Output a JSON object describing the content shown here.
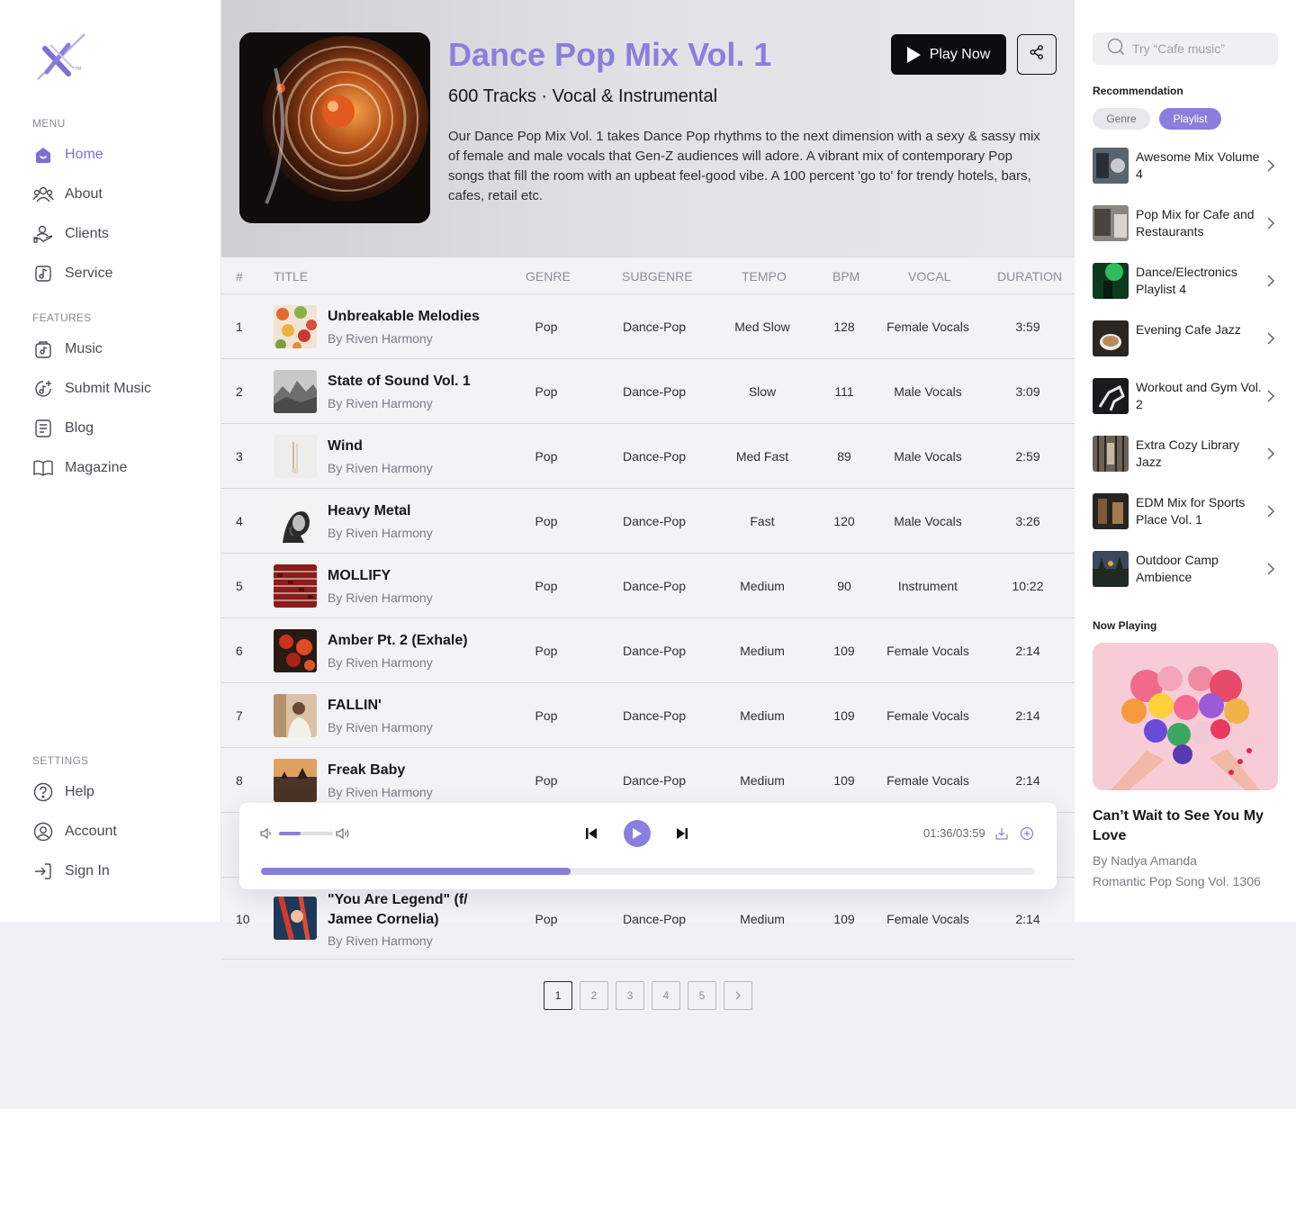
{
  "sidebar": {
    "menu_label": "MENU",
    "features_label": "FEATURES",
    "settings_label": "SETTINGS",
    "menu": [
      {
        "label": "Home",
        "icon": "home-icon",
        "active": true
      },
      {
        "label": "About",
        "icon": "people-icon"
      },
      {
        "label": "Clients",
        "icon": "clients-icon"
      },
      {
        "label": "Service",
        "icon": "service-icon"
      }
    ],
    "features": [
      {
        "label": "Music",
        "icon": "music-icon"
      },
      {
        "label": "Submit Music",
        "icon": "submit-music-icon"
      },
      {
        "label": "Blog",
        "icon": "blog-icon"
      },
      {
        "label": "Magazine",
        "icon": "book-icon"
      }
    ],
    "settings": [
      {
        "label": "Help",
        "icon": "help-icon"
      },
      {
        "label": "Account",
        "icon": "account-icon"
      },
      {
        "label": "Sign In",
        "icon": "sign-in-icon"
      }
    ]
  },
  "hero": {
    "title": "Dance Pop Mix Vol. 1",
    "subtitle": "600 Tracks · Vocal & Instrumental",
    "description": "Our Dance Pop Mix Vol. 1 takes Dance Pop rhythms to the next dimension with a  sexy & sassy mix of female and male vocals that Gen-Z audiences will adore. A vibrant mix of contemporary Pop songs that fill the room with an upbeat feel-good vibe. A 100 percent 'go to' for trendy hotels, bars, cafes, retail etc.",
    "play_label": "Play Now"
  },
  "table": {
    "headers": {
      "num": "#",
      "title": "TITLE",
      "genre": "GENRE",
      "subgenre": "SUBGENRE",
      "tempo": "TEMPO",
      "bpm": "BPM",
      "vocal": "VOCAL",
      "duration": "DURATION"
    },
    "rows": [
      {
        "num": "1",
        "title": "Unbreakable Melodies",
        "artist": "By Riven Harmony",
        "genre": "Pop",
        "subgenre": "Dance-Pop",
        "tempo": "Med Slow",
        "bpm": "128",
        "vocal": "Female Vocals",
        "duration": "3:59"
      },
      {
        "num": "2",
        "title": "State of Sound Vol. 1",
        "artist": "By Riven Harmony",
        "genre": "Pop",
        "subgenre": "Dance-Pop",
        "tempo": "Slow",
        "bpm": "111",
        "vocal": "Male Vocals",
        "duration": "3:09"
      },
      {
        "num": "3",
        "title": "Wind",
        "artist": "By Riven Harmony",
        "genre": "Pop",
        "subgenre": "Dance-Pop",
        "tempo": "Med Fast",
        "bpm": "89",
        "vocal": "Male Vocals",
        "duration": "2:59"
      },
      {
        "num": "4",
        "title": "Heavy Metal",
        "artist": "By Riven Harmony",
        "genre": "Pop",
        "subgenre": "Dance-Pop",
        "tempo": "Fast",
        "bpm": "120",
        "vocal": "Male Vocals",
        "duration": "3:26"
      },
      {
        "num": "5",
        "title": "MOLLIFY",
        "artist": "By Riven Harmony",
        "genre": "Pop",
        "subgenre": "Dance-Pop",
        "tempo": "Medium",
        "bpm": "90",
        "vocal": "Instrument",
        "duration": "10:22"
      },
      {
        "num": "6",
        "title": "Amber Pt. 2 (Exhale)",
        "artist": "By Riven Harmony",
        "genre": "Pop",
        "subgenre": "Dance-Pop",
        "tempo": "Medium",
        "bpm": "109",
        "vocal": "Female Vocals",
        "duration": "2:14"
      },
      {
        "num": "7",
        "title": "FALLIN'",
        "artist": "By Riven Harmony",
        "genre": "Pop",
        "subgenre": "Dance-Pop",
        "tempo": "Medium",
        "bpm": "109",
        "vocal": "Female Vocals",
        "duration": "2:14"
      },
      {
        "num": "8",
        "title": "Freak Baby",
        "artist": "By Riven Harmony",
        "genre": "Pop",
        "subgenre": "Dance-Pop",
        "tempo": "Medium",
        "bpm": "109",
        "vocal": "Female Vocals",
        "duration": "2:14"
      },
      {
        "num": "10",
        "title": "\"You Are Legend\" (f/ Jamee Cornelia)",
        "artist": "By Riven Harmony",
        "genre": "Pop",
        "subgenre": "Dance-Pop",
        "tempo": "Medium",
        "bpm": "109",
        "vocal": "Female Vocals",
        "duration": "2:14"
      }
    ]
  },
  "player": {
    "time": "01:36/03:59",
    "progress_fraction": 0.4,
    "volume_fraction": 0.4
  },
  "pagination": {
    "pages": [
      "1",
      "2",
      "3",
      "4",
      "5"
    ],
    "current": "1"
  },
  "right": {
    "search_placeholder": "Try “Cafe music”",
    "recommendation_label": "Recommendation",
    "chips": {
      "genre": "Genre",
      "playlist": "Playlist"
    },
    "playlists": [
      {
        "title": "Awesome Mix Volume 4"
      },
      {
        "title": "Pop Mix for Cafe and Restaurants"
      },
      {
        "title": "Dance/Electronics Playlist 4"
      },
      {
        "title": "Evening Cafe Jazz"
      },
      {
        "title": "Workout and Gym Vol. 2"
      },
      {
        "title": "Extra Cozy Library Jazz"
      },
      {
        "title": "EDM Mix for Sports Place Vol. 1"
      },
      {
        "title": "Outdoor Camp Ambience"
      }
    ],
    "now_playing_label": "Now Playing",
    "now_playing": {
      "title": "Can’t Wait to See You My Love",
      "artist": "By Nadya Amanda",
      "album": "Romantic Pop Song Vol. 1306"
    }
  },
  "colors": {
    "accent": "#8a7fdc",
    "dark": "#0d0d10"
  }
}
